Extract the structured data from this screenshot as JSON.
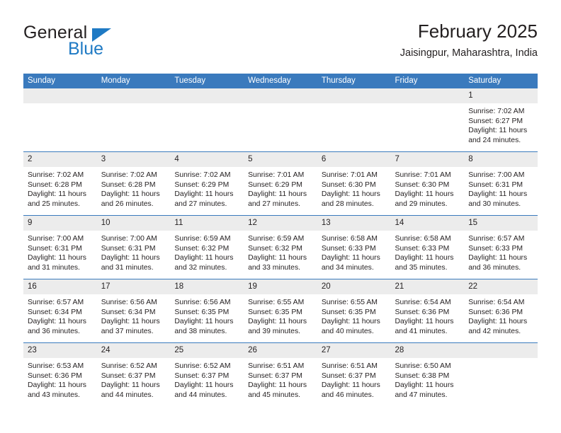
{
  "brand": {
    "name_part1": "General",
    "name_part2": "Blue",
    "triangle_color": "#1f7ac4"
  },
  "header": {
    "title": "February 2025",
    "subtitle": "Jaisingpur, Maharashtra, India"
  },
  "theme": {
    "header_blue": "#3a7abd",
    "daynum_gray": "#ececec",
    "text": "#231f20"
  },
  "calendar": {
    "weekday_headers": [
      "Sunday",
      "Monday",
      "Tuesday",
      "Wednesday",
      "Thursday",
      "Friday",
      "Saturday"
    ],
    "weeks": [
      [
        {
          "day": "",
          "sunrise": "",
          "sunset": "",
          "daylight": "",
          "daylight2": ""
        },
        {
          "day": "",
          "sunrise": "",
          "sunset": "",
          "daylight": "",
          "daylight2": ""
        },
        {
          "day": "",
          "sunrise": "",
          "sunset": "",
          "daylight": "",
          "daylight2": ""
        },
        {
          "day": "",
          "sunrise": "",
          "sunset": "",
          "daylight": "",
          "daylight2": ""
        },
        {
          "day": "",
          "sunrise": "",
          "sunset": "",
          "daylight": "",
          "daylight2": ""
        },
        {
          "day": "",
          "sunrise": "",
          "sunset": "",
          "daylight": "",
          "daylight2": ""
        },
        {
          "day": "1",
          "sunrise": "Sunrise: 7:02 AM",
          "sunset": "Sunset: 6:27 PM",
          "daylight": "Daylight: 11 hours",
          "daylight2": "and 24 minutes."
        }
      ],
      [
        {
          "day": "2",
          "sunrise": "Sunrise: 7:02 AM",
          "sunset": "Sunset: 6:28 PM",
          "daylight": "Daylight: 11 hours",
          "daylight2": "and 25 minutes."
        },
        {
          "day": "3",
          "sunrise": "Sunrise: 7:02 AM",
          "sunset": "Sunset: 6:28 PM",
          "daylight": "Daylight: 11 hours",
          "daylight2": "and 26 minutes."
        },
        {
          "day": "4",
          "sunrise": "Sunrise: 7:02 AM",
          "sunset": "Sunset: 6:29 PM",
          "daylight": "Daylight: 11 hours",
          "daylight2": "and 27 minutes."
        },
        {
          "day": "5",
          "sunrise": "Sunrise: 7:01 AM",
          "sunset": "Sunset: 6:29 PM",
          "daylight": "Daylight: 11 hours",
          "daylight2": "and 27 minutes."
        },
        {
          "day": "6",
          "sunrise": "Sunrise: 7:01 AM",
          "sunset": "Sunset: 6:30 PM",
          "daylight": "Daylight: 11 hours",
          "daylight2": "and 28 minutes."
        },
        {
          "day": "7",
          "sunrise": "Sunrise: 7:01 AM",
          "sunset": "Sunset: 6:30 PM",
          "daylight": "Daylight: 11 hours",
          "daylight2": "and 29 minutes."
        },
        {
          "day": "8",
          "sunrise": "Sunrise: 7:00 AM",
          "sunset": "Sunset: 6:31 PM",
          "daylight": "Daylight: 11 hours",
          "daylight2": "and 30 minutes."
        }
      ],
      [
        {
          "day": "9",
          "sunrise": "Sunrise: 7:00 AM",
          "sunset": "Sunset: 6:31 PM",
          "daylight": "Daylight: 11 hours",
          "daylight2": "and 31 minutes."
        },
        {
          "day": "10",
          "sunrise": "Sunrise: 7:00 AM",
          "sunset": "Sunset: 6:31 PM",
          "daylight": "Daylight: 11 hours",
          "daylight2": "and 31 minutes."
        },
        {
          "day": "11",
          "sunrise": "Sunrise: 6:59 AM",
          "sunset": "Sunset: 6:32 PM",
          "daylight": "Daylight: 11 hours",
          "daylight2": "and 32 minutes."
        },
        {
          "day": "12",
          "sunrise": "Sunrise: 6:59 AM",
          "sunset": "Sunset: 6:32 PM",
          "daylight": "Daylight: 11 hours",
          "daylight2": "and 33 minutes."
        },
        {
          "day": "13",
          "sunrise": "Sunrise: 6:58 AM",
          "sunset": "Sunset: 6:33 PM",
          "daylight": "Daylight: 11 hours",
          "daylight2": "and 34 minutes."
        },
        {
          "day": "14",
          "sunrise": "Sunrise: 6:58 AM",
          "sunset": "Sunset: 6:33 PM",
          "daylight": "Daylight: 11 hours",
          "daylight2": "and 35 minutes."
        },
        {
          "day": "15",
          "sunrise": "Sunrise: 6:57 AM",
          "sunset": "Sunset: 6:33 PM",
          "daylight": "Daylight: 11 hours",
          "daylight2": "and 36 minutes."
        }
      ],
      [
        {
          "day": "16",
          "sunrise": "Sunrise: 6:57 AM",
          "sunset": "Sunset: 6:34 PM",
          "daylight": "Daylight: 11 hours",
          "daylight2": "and 36 minutes."
        },
        {
          "day": "17",
          "sunrise": "Sunrise: 6:56 AM",
          "sunset": "Sunset: 6:34 PM",
          "daylight": "Daylight: 11 hours",
          "daylight2": "and 37 minutes."
        },
        {
          "day": "18",
          "sunrise": "Sunrise: 6:56 AM",
          "sunset": "Sunset: 6:35 PM",
          "daylight": "Daylight: 11 hours",
          "daylight2": "and 38 minutes."
        },
        {
          "day": "19",
          "sunrise": "Sunrise: 6:55 AM",
          "sunset": "Sunset: 6:35 PM",
          "daylight": "Daylight: 11 hours",
          "daylight2": "and 39 minutes."
        },
        {
          "day": "20",
          "sunrise": "Sunrise: 6:55 AM",
          "sunset": "Sunset: 6:35 PM",
          "daylight": "Daylight: 11 hours",
          "daylight2": "and 40 minutes."
        },
        {
          "day": "21",
          "sunrise": "Sunrise: 6:54 AM",
          "sunset": "Sunset: 6:36 PM",
          "daylight": "Daylight: 11 hours",
          "daylight2": "and 41 minutes."
        },
        {
          "day": "22",
          "sunrise": "Sunrise: 6:54 AM",
          "sunset": "Sunset: 6:36 PM",
          "daylight": "Daylight: 11 hours",
          "daylight2": "and 42 minutes."
        }
      ],
      [
        {
          "day": "23",
          "sunrise": "Sunrise: 6:53 AM",
          "sunset": "Sunset: 6:36 PM",
          "daylight": "Daylight: 11 hours",
          "daylight2": "and 43 minutes."
        },
        {
          "day": "24",
          "sunrise": "Sunrise: 6:52 AM",
          "sunset": "Sunset: 6:37 PM",
          "daylight": "Daylight: 11 hours",
          "daylight2": "and 44 minutes."
        },
        {
          "day": "25",
          "sunrise": "Sunrise: 6:52 AM",
          "sunset": "Sunset: 6:37 PM",
          "daylight": "Daylight: 11 hours",
          "daylight2": "and 44 minutes."
        },
        {
          "day": "26",
          "sunrise": "Sunrise: 6:51 AM",
          "sunset": "Sunset: 6:37 PM",
          "daylight": "Daylight: 11 hours",
          "daylight2": "and 45 minutes."
        },
        {
          "day": "27",
          "sunrise": "Sunrise: 6:51 AM",
          "sunset": "Sunset: 6:37 PM",
          "daylight": "Daylight: 11 hours",
          "daylight2": "and 46 minutes."
        },
        {
          "day": "28",
          "sunrise": "Sunrise: 6:50 AM",
          "sunset": "Sunset: 6:38 PM",
          "daylight": "Daylight: 11 hours",
          "daylight2": "and 47 minutes."
        },
        {
          "day": "",
          "sunrise": "",
          "sunset": "",
          "daylight": "",
          "daylight2": ""
        }
      ]
    ]
  }
}
